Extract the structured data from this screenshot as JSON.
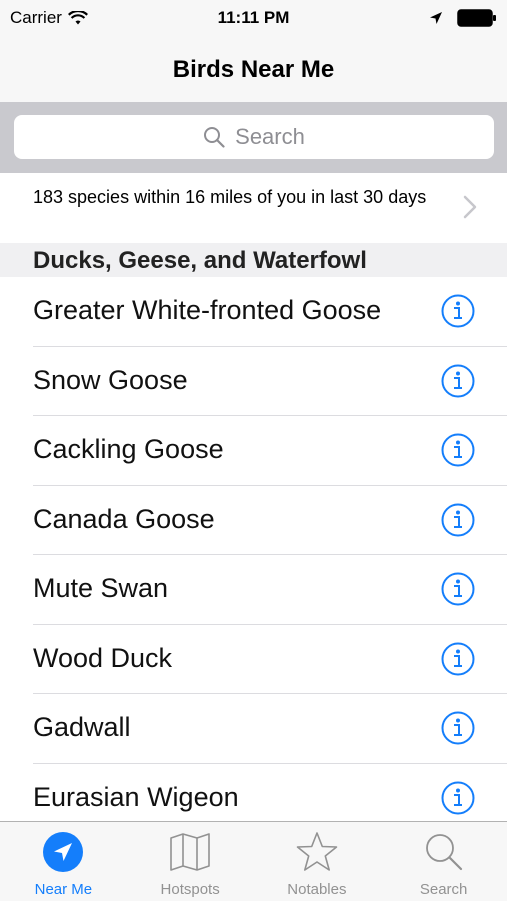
{
  "status_bar": {
    "carrier": "Carrier",
    "time": "11:11 PM"
  },
  "nav": {
    "title": "Birds Near Me"
  },
  "search": {
    "placeholder": "Search"
  },
  "summary": {
    "text": "183 species within 16 miles of you in last 30 days"
  },
  "section": {
    "title": "Ducks, Geese, and Waterfowl"
  },
  "birds": [
    "Greater White-fronted Goose",
    "Snow Goose",
    "Cackling Goose",
    "Canada Goose",
    "Mute Swan",
    "Wood Duck",
    "Gadwall",
    "Eurasian Wigeon"
  ],
  "tabs": [
    {
      "label": "Near Me",
      "icon": "location-arrow-icon",
      "active": true
    },
    {
      "label": "Hotspots",
      "icon": "map-icon",
      "active": false
    },
    {
      "label": "Notables",
      "icon": "star-icon",
      "active": false
    },
    {
      "label": "Search",
      "icon": "search-icon",
      "active": false
    }
  ],
  "colors": {
    "accent": "#147efb",
    "inactive": "#929292",
    "separator": "#dcdce0",
    "search_bar_bg": "#c9c9ce"
  }
}
